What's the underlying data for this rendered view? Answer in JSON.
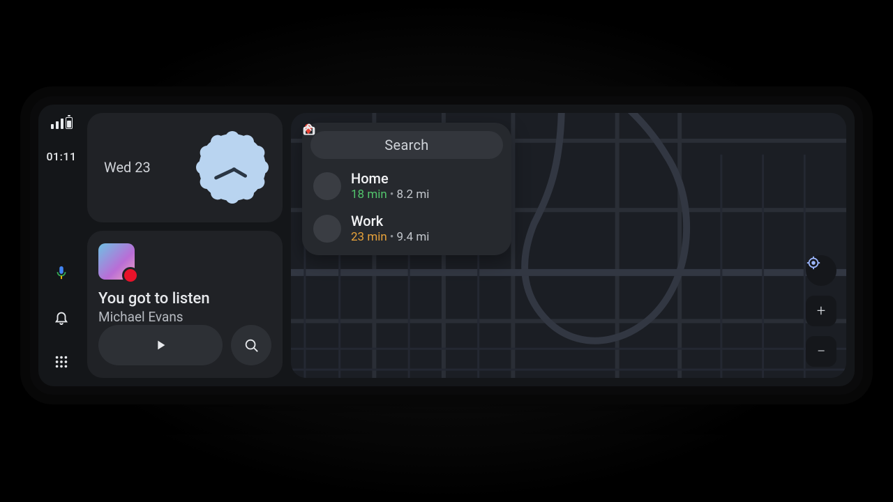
{
  "status": {
    "time": "01:11"
  },
  "clock_card": {
    "date_label": "Wed 23"
  },
  "media": {
    "track": "You got to listen",
    "artist": "Michael Evans"
  },
  "search": {
    "label": "Search"
  },
  "destinations": [
    {
      "title": "Home",
      "eta": "18 min",
      "eta_tone": "green",
      "distance": "8.2 mi",
      "icon": "home"
    },
    {
      "title": "Work",
      "eta": "23 min",
      "eta_tone": "amber",
      "distance": "9.4 mi",
      "icon": "briefcase"
    }
  ],
  "map_controls": {
    "zoom_in": "+",
    "zoom_out": "−"
  }
}
